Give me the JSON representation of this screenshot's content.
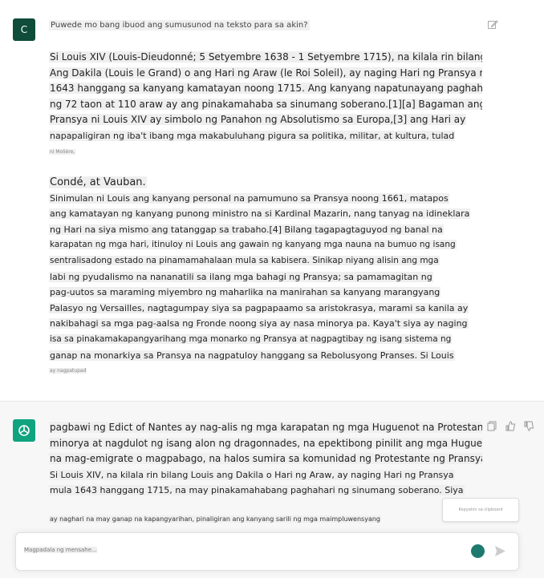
{
  "user": {
    "avatar_letter": "C",
    "question": "Puwede mo bang ibuod ang sumusunod na teksto para sa akin?",
    "paragraph1": [
      "Si Louis XIV (Louis-Dieudonné; 5 Setyembre 1638 - 1 Setyembre 1715), na kilala rin bilang Louis",
      " Ang Dakila (Louis le Grand) o ang Hari ng Araw (le Roi Soleil), ay naging Hari ng Pransya mula",
      "1643 hanggang sa kanyang kamatayan noong 1715. Ang kanyang napatunayang paghahari",
      "ng 72 taon at 110 araw ay ang pinakamahaba sa sinumang soberano.[1][a] Bagaman ang",
      "Pransya ni Louis XIV ay simbolo ng Panahon ng Absolutismo sa Europa,[3] ang Hari ay",
      "napapaligiran ng iba't ibang mga makabuluhang pigura sa politika, militar, at kultura, tulad",
      "ni Molière,"
    ],
    "paragraph2": [
      "Condé, at Vauban.",
      "Sinimulan ni Louis ang kanyang personal na pamumuno sa Pransya noong 1661, matapos",
      "ang kamatayan ng kanyang punong ministro na si Kardinal Mazarin, nang tanyag na idineklara",
      "ng Hari na siya mismo ang tatanggap sa trabaho.[4] Bilang tagapagtaguyod ng banal na",
      "karapatan ng mga hari, itinuloy ni Louis ang gawain ng kanyang mga nauna na bumuo ng isang",
      "sentralisadong estado na pinamamahalaan mula sa kabisera. Sinikap niyang alisin ang mga",
      "labi ng pyudalismo na nananatili sa ilang mga bahagi ng Pransya; sa pamamagitan ng",
      "pag-uutos sa maraming miyembro ng maharlika na manirahan sa kanyang marangyang",
      "Palasyo ng Versailles, nagtagumpay siya sa pagpapaamo sa aristokrasya, marami sa kanila ay",
      "nakibahagi sa mga pag-aalsa ng Fronde noong siya ay nasa minorya pa. Kaya't siya ay naging",
      "isa sa pinakamakapangyarihang mga monarko ng Pransya at nagpagtibay ng isang sistema ng",
      "ganap na monarkiya sa Pransya na nagpatuloy hanggang sa Rebolusyong Pranses. Si Louis",
      "ay nagpatupad"
    ]
  },
  "assistant": {
    "paragraph": [
      "pagbawi ng Edict of Nantes ay nag-alis ng mga karapatan ng mga Huguenot na Protestanteng",
      "minorya at nagdulot ng isang alon ng dragonnades, na epektibong pinilit ang mga Huguenot",
      "na mag-emigrate o magpabago, na halos sumira sa komunidad ng Protestante ng Pransya.",
      "Si Louis XIV, na kilala rin bilang Louis ang Dakila o Hari ng Araw, ay naging Hari ng Pransya",
      "mula 1643 hanggang 1715, na may pinakamahabang paghahari ng sinumang soberano. Siya"
    ],
    "small_note": "ay naghari na may ganap na kapangyarihan, pinaligiran ang kanyang sarili ng mga maimpluwensyang",
    "tooltip_text": "Kopyahin sa clipboard"
  },
  "composer": {
    "input_text": "Magpadala ng mensahe..."
  },
  "icons": {
    "edit": "edit-icon",
    "copy": "copy-icon",
    "thumbs_up": "thumbs-up-icon",
    "thumbs_down": "thumbs-down-icon",
    "send": "send-icon",
    "translate": "translate-icon",
    "assistant_logo": "openai-logo-icon"
  }
}
